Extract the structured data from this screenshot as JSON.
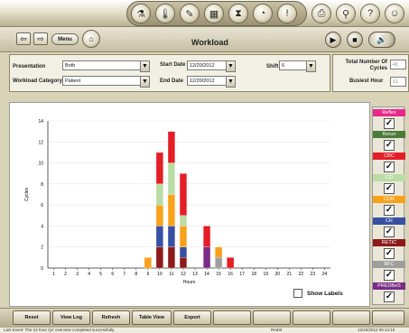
{
  "window": {
    "title": "Workload"
  },
  "toolbar": {
    "icons": [
      "reagent-icon",
      "thermometer-icon",
      "document-icon",
      "keyboard-icon",
      "hourglass-icon",
      "gauge-icon",
      "alert-icon",
      "printer-icon",
      "magnifier-icon",
      "help-icon",
      "user-icon"
    ]
  },
  "nav": {
    "back": "⇦",
    "forward": "⇨",
    "menu_label": "Menu"
  },
  "filters": {
    "presentation_label": "Presentation",
    "presentation_value": "Both",
    "category_label": "Workload Category",
    "category_value": "Patient",
    "start_label": "Start Date",
    "start_value": "12/20/2012",
    "end_label": "End Date",
    "end_value": "12/20/2012",
    "shift_label": "Shift",
    "shift_value": "6"
  },
  "stats": {
    "total_label": "Total Number Of Cycles",
    "total_value": "41",
    "busiest_label": "Busiest Hour",
    "busiest_value": "11"
  },
  "legend": [
    {
      "name": "Reflex",
      "color": "#e8288a"
    },
    {
      "name": "Rerun",
      "color": "#4b7a3b"
    },
    {
      "name": "CBC",
      "color": "#e41e26"
    },
    {
      "name": "CD",
      "color": "#b9dda4"
    },
    {
      "name": "CDR",
      "color": "#f7a21b"
    },
    {
      "name": "CR",
      "color": "#3650a2"
    },
    {
      "name": "RETIC",
      "color": "#8c1a1a"
    },
    {
      "name": "BFC",
      "color": "#9e9e9e"
    },
    {
      "name": "PREDBeS",
      "color": "#7a2b86"
    }
  ],
  "show_labels": "Show Labels",
  "buttons": [
    "Reset",
    "View Log",
    "Refresh",
    "Table View",
    "Export"
  ],
  "status": {
    "left": "Last Event: The 24 hour QV overview completed successfully.",
    "mid": "RedSt",
    "right": "12/20/2012 09:14:10"
  },
  "chart_data": {
    "type": "bar",
    "stacked": true,
    "xlabel": "Hours",
    "ylabel": "Cycles",
    "ylim": [
      0,
      14
    ],
    "yticks": [
      0,
      2,
      4,
      6,
      8,
      10,
      12,
      14
    ],
    "categories": [
      "1",
      "2",
      "3",
      "4",
      "5",
      "6",
      "7",
      "8",
      "9",
      "10",
      "11",
      "12",
      "13",
      "14",
      "15",
      "16",
      "17",
      "18",
      "19",
      "20",
      "21",
      "22",
      "23",
      "24"
    ],
    "series": [
      {
        "name": "RETIC",
        "color": "#8c1a1a",
        "values": [
          0,
          0,
          0,
          0,
          0,
          0,
          0,
          0,
          0,
          2,
          2,
          1,
          0,
          0,
          0,
          0,
          0,
          0,
          0,
          0,
          0,
          0,
          0,
          0
        ]
      },
      {
        "name": "CR",
        "color": "#3650a2",
        "values": [
          0,
          0,
          0,
          0,
          0,
          0,
          0,
          0,
          0,
          2,
          2,
          1,
          0,
          0,
          0,
          0,
          0,
          0,
          0,
          0,
          0,
          0,
          0,
          0
        ]
      },
      {
        "name": "PREDBeS",
        "color": "#7a2b86",
        "values": [
          0,
          0,
          0,
          0,
          0,
          0,
          0,
          0,
          0,
          0,
          0,
          0,
          0,
          2,
          0,
          0,
          0,
          0,
          0,
          0,
          0,
          0,
          0,
          0
        ]
      },
      {
        "name": "BFC",
        "color": "#9e9e9e",
        "values": [
          0,
          0,
          0,
          0,
          0,
          0,
          0,
          0,
          0,
          0,
          0,
          0,
          0,
          0,
          1,
          0,
          0,
          0,
          0,
          0,
          0,
          0,
          0,
          0
        ]
      },
      {
        "name": "CDR",
        "color": "#f7a21b",
        "values": [
          0,
          0,
          0,
          0,
          0,
          0,
          0,
          0,
          1,
          2,
          3,
          2,
          0,
          0,
          1,
          0,
          0,
          0,
          0,
          0,
          0,
          0,
          0,
          0
        ]
      },
      {
        "name": "CD",
        "color": "#b9dda4",
        "values": [
          0,
          0,
          0,
          0,
          0,
          0,
          0,
          0,
          0,
          2,
          3,
          1,
          0,
          0,
          0,
          0,
          0,
          0,
          0,
          0,
          0,
          0,
          0,
          0
        ]
      },
      {
        "name": "CBC",
        "color": "#e41e26",
        "values": [
          0,
          0,
          0,
          0,
          0,
          0,
          0,
          0,
          0,
          3,
          3,
          4,
          0,
          2,
          0,
          1,
          0,
          0,
          0,
          0,
          0,
          0,
          0,
          0
        ]
      }
    ]
  }
}
